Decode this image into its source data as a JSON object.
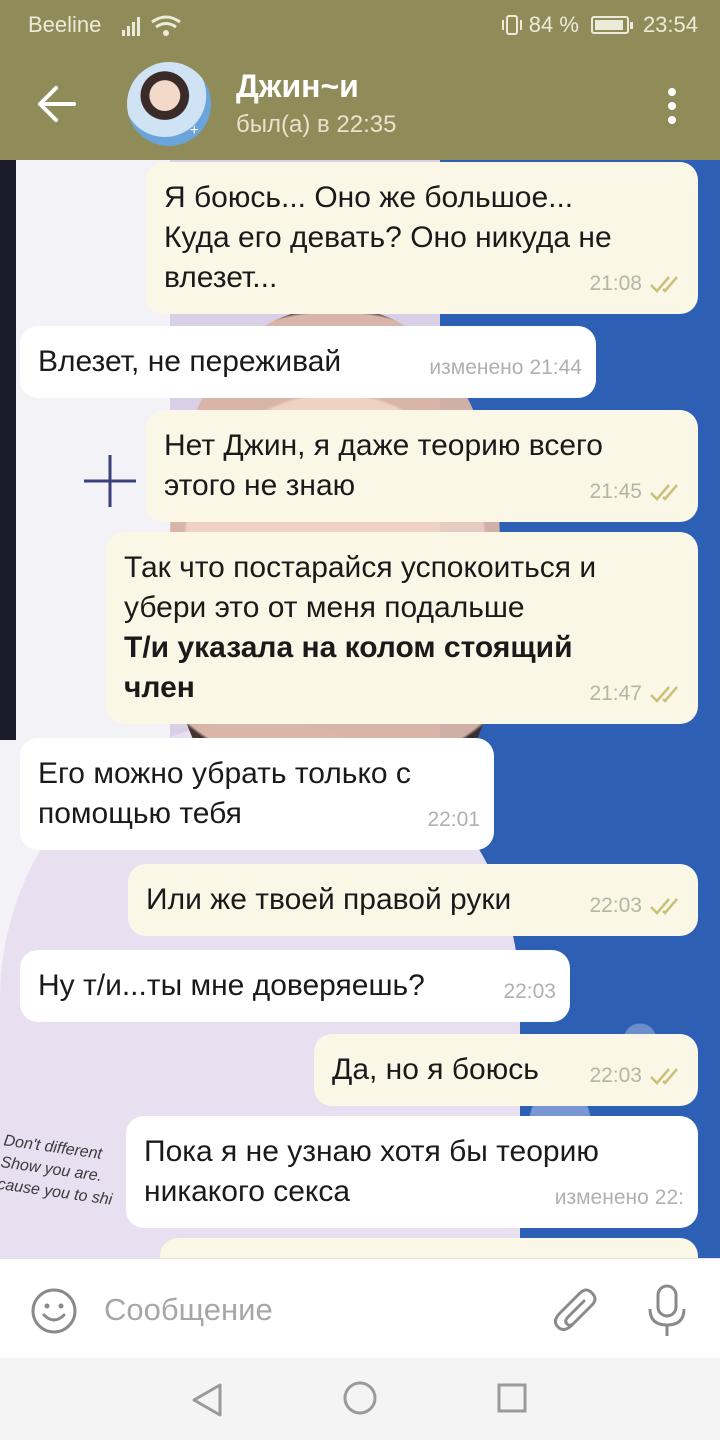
{
  "status_bar": {
    "carrier": "Beeline",
    "battery": "84 %",
    "battery_level": 0.84,
    "time": "23:54"
  },
  "header": {
    "contact_name": "Джин~и",
    "last_seen": "был(а) в 22:35"
  },
  "messages": [
    {
      "direction": "out",
      "text": "Я боюсь... Оно же большое...\nКуда его девать? Оно никуда не\nвлезет...",
      "time": "21:08",
      "read": true
    },
    {
      "direction": "in",
      "text": "Влезет, не переживай",
      "edited_label": "изменено",
      "time": "21:44"
    },
    {
      "direction": "out",
      "text": "Нет Джин, я даже теорию всего\nэтого не знаю",
      "time": "21:45",
      "read": true
    },
    {
      "direction": "out",
      "text": "Так что постарайся успокоиться и\nубери это от меня подальше",
      "bold_text": "Т/и указала на колом стоящий\nчлен",
      "time": "21:47",
      "read": true
    },
    {
      "direction": "in",
      "text": "Его можно убрать только с\nпомощью тебя",
      "time": "22:01"
    },
    {
      "direction": "out",
      "text": "Или же твоей правой руки",
      "time": "22:03",
      "read": true
    },
    {
      "direction": "in",
      "text": "Ну т/и...ты мне доверяешь?",
      "time": "22:03"
    },
    {
      "direction": "out",
      "text": "Да, но я боюсь",
      "time": "22:03",
      "read": true
    },
    {
      "direction": "in",
      "text": "Пока я не узнаю хотя бы теорию\nникакого секса",
      "edited_label": "изменено",
      "time": "22:"
    }
  ],
  "wallpaper_text": "Don't different\nShow you are.\ncause you to shi",
  "input": {
    "placeholder": "Сообщение"
  },
  "colors": {
    "header": "#8f8c5a",
    "outgoing_bubble": "#fbf7e7",
    "incoming_bubble": "#ffffff",
    "read_ticks": "#c9c07a"
  }
}
